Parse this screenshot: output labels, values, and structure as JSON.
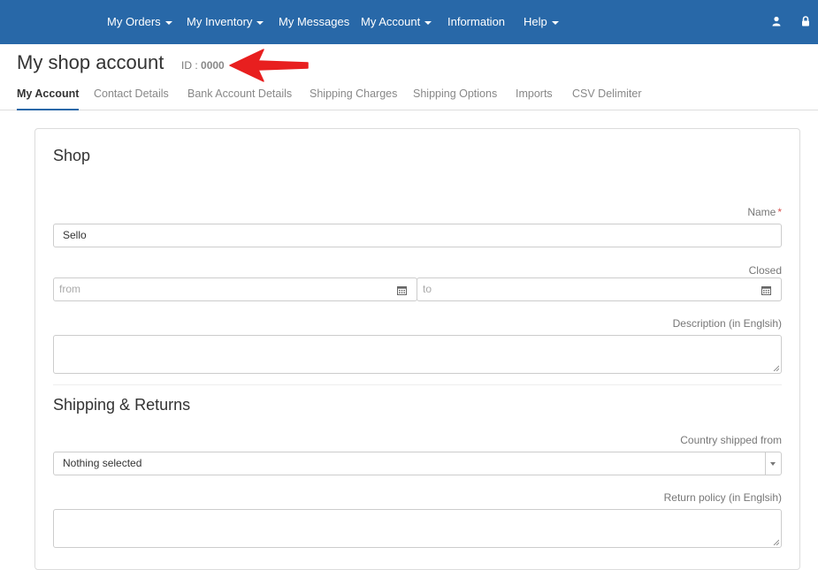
{
  "nav": {
    "items": [
      {
        "label": "My Orders",
        "dropdown": true
      },
      {
        "label": "My Inventory",
        "dropdown": true
      },
      {
        "label": "My Messages",
        "dropdown": false
      },
      {
        "label": "My Account",
        "dropdown": true
      },
      {
        "label": "Information",
        "dropdown": false
      },
      {
        "label": "Help",
        "dropdown": true
      }
    ],
    "icons": [
      "user-icon",
      "lock-icon"
    ],
    "background": "#2868a8"
  },
  "header": {
    "title": "My shop account",
    "id_label": "ID :",
    "id_value": "0000",
    "annotation": "red-arrow-icon"
  },
  "tabs": [
    {
      "label": "My Account",
      "active": true
    },
    {
      "label": "Contact Details",
      "active": false
    },
    {
      "label": "Bank Account Details",
      "active": false
    },
    {
      "label": "Shipping Charges",
      "active": false
    },
    {
      "label": "Shipping Options",
      "active": false
    },
    {
      "label": "Imports",
      "active": false
    },
    {
      "label": "CSV Delimiter",
      "active": false
    }
  ],
  "shop": {
    "section_title": "Shop",
    "name_label": "Name",
    "name_required": "*",
    "name_value": "Sello",
    "closed_label": "Closed",
    "from_placeholder": "from",
    "to_placeholder": "to",
    "description_label": "Description (in Englsih)",
    "description_value": ""
  },
  "shipping": {
    "section_title": "Shipping & Returns",
    "country_label": "Country shipped from",
    "country_value": "Nothing selected",
    "return_label": "Return policy (in Englsih)",
    "return_value": ""
  }
}
